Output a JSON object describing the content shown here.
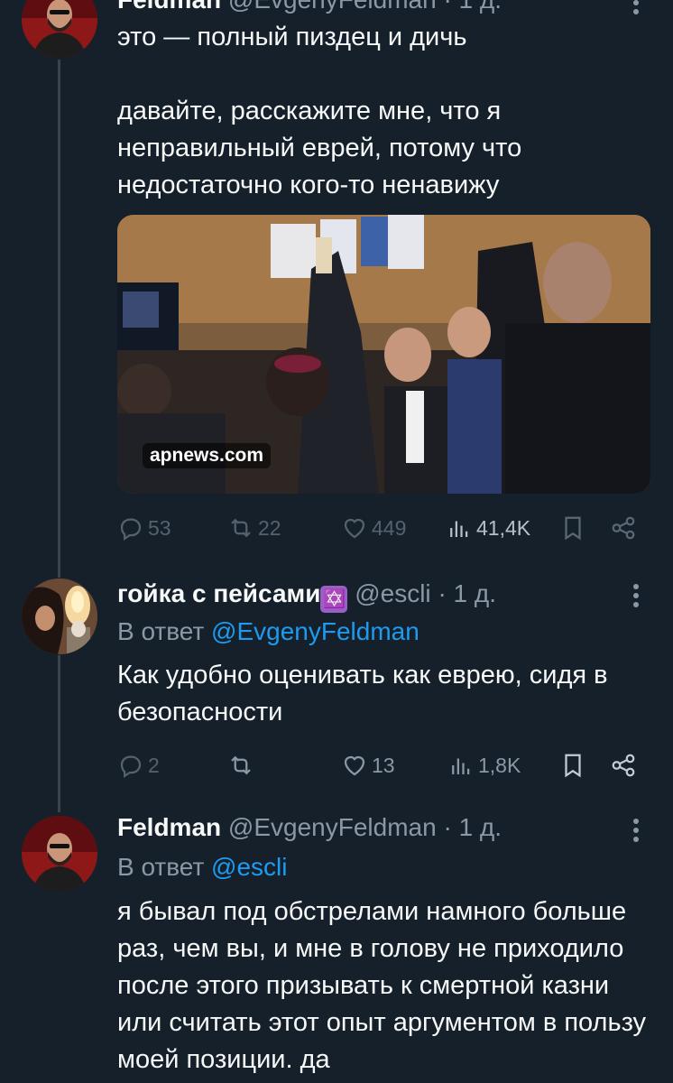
{
  "tweet1": {
    "name": "Feldman",
    "handle": "@EvgenyFeldman",
    "time": "1 д.",
    "text": [
      "это — полный пиздец и дичь",
      "",
      "давайте, расскажите мне, что я неправильный еврей, потому что недостаточно кого-то ненавижу"
    ],
    "image_source": "apnews.com",
    "replies": "53",
    "reposts": "22",
    "likes": "449",
    "views": "41,4K"
  },
  "tweet2": {
    "name": "гойка с пейсами",
    "name_emoji": "✡️",
    "handle": "@escli",
    "time": "1 д.",
    "reply_prefix": "В ответ",
    "reply_handle": "@EvgenyFeldman",
    "text": "Как удобно оценивать как еврею, сидя в безопасности",
    "replies": "2",
    "likes": "13",
    "views": "1,8K"
  },
  "tweet3": {
    "name": "Feldman",
    "handle": "@EvgenyFeldman",
    "time": "1 д.",
    "reply_prefix": "В ответ",
    "reply_handle": "@escli",
    "text": "я бывал под обстрелами намного больше раз, чем вы, и мне в голову не приходило после этого призывать к смертной казни или считать этот опыт аргументом в пользу моей позиции. да"
  },
  "separator": "·",
  "icons": {
    "reply": "reply-icon",
    "repost": "repost-icon",
    "like": "heart-icon",
    "views": "views-icon",
    "bookmark": "bookmark-icon",
    "share": "share-icon",
    "more": "more-icon"
  },
  "colors": {
    "background": "#15202b",
    "text": "#f7f9f9",
    "muted": "#8b98a5",
    "link": "#1d9bf0",
    "thread_line": "#38444d"
  }
}
